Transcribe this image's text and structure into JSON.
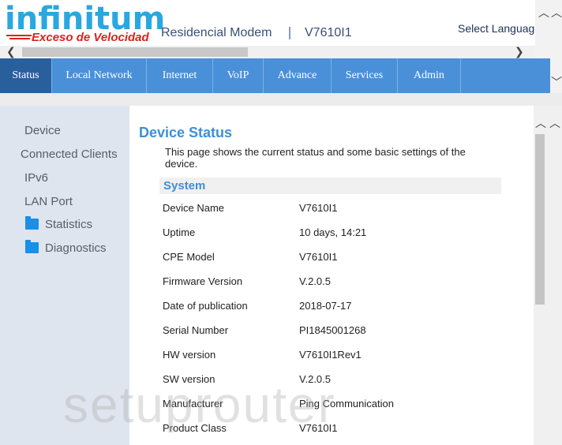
{
  "header": {
    "logo_main": "infinitum",
    "logo_sub": "Exceso de Velocidad",
    "model_label": "Residencial Modem",
    "device_name": "V7610I1",
    "language_label": "Select Language"
  },
  "nav": {
    "items": [
      {
        "label": "Status",
        "active": true
      },
      {
        "label": "Local Network"
      },
      {
        "label": "Internet"
      },
      {
        "label": "VoIP"
      },
      {
        "label": "Advance"
      },
      {
        "label": "Services"
      },
      {
        "label": "Admin"
      }
    ]
  },
  "sidebar": {
    "items": [
      {
        "label": "Device"
      },
      {
        "label": "Connected Clients"
      },
      {
        "label": "IPv6"
      },
      {
        "label": "LAN Port"
      },
      {
        "label": "Statistics",
        "icon": "folder-icon"
      },
      {
        "label": "Diagnostics",
        "icon": "folder-icon"
      }
    ]
  },
  "content": {
    "title": "Device Status",
    "description": "This page shows the current status and some basic settings of the device.",
    "section_title": "System",
    "rows": [
      {
        "label": "Device Name",
        "value": "V7610I1"
      },
      {
        "label": "Uptime",
        "value": "10 days, 14:21"
      },
      {
        "label": "CPE Model",
        "value": "V7610I1"
      },
      {
        "label": "Firmware Version",
        "value": "V.2.0.5"
      },
      {
        "label": "Date of publication",
        "value": "2018-07-17"
      },
      {
        "label": "Serial Number",
        "value": "PI1845001268"
      },
      {
        "label": "HW version",
        "value": "V7610I1Rev1"
      },
      {
        "label": "SW version",
        "value": "V.2.0.5"
      },
      {
        "label": "Manufacturer",
        "value": "Ping Communication"
      },
      {
        "label": "Product Class",
        "value": "V7610I1"
      }
    ]
  },
  "watermark": "setuprouter",
  "colors": {
    "nav_bg": "#4a90d9",
    "nav_active": "#2a5f9e",
    "title_blue": "#3d8fd8",
    "logo_blue": "#2aa7e0",
    "logo_red": "#d8241c",
    "sidebar_bg": "#dfe5ee"
  }
}
